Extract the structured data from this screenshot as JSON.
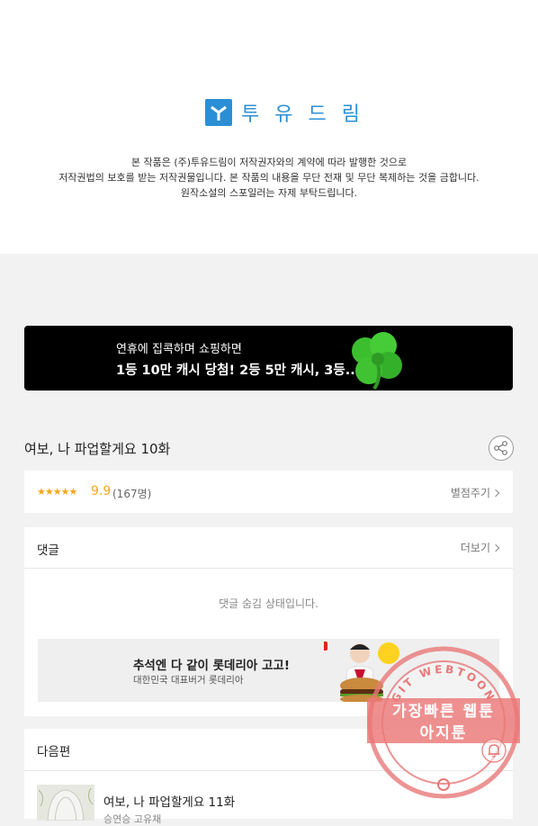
{
  "header": {
    "logo_text": "투 유 드 림",
    "notice": [
      "본 작품은 (주)투유드림이 저작권자와의 계약에 따라 발행한 것으로",
      "저작권법의 보호를 받는 저작권물입니다. 본 작품의 내용을 무단 전재 및 무단 복제하는 것을 금합니다.",
      "원작소설의 스포일러는 자제 부탁드립니다."
    ]
  },
  "banner": {
    "line1": "연휴에 집콕하며 쇼핑하면",
    "line2": "1등 10만 캐시 당첨! 2등 5만 캐시, 3등.."
  },
  "episode": {
    "title": "여보, 나 파업할게요 10화",
    "share_icon": "share-icon"
  },
  "rating": {
    "stars": "★★★★★",
    "score": "9.9",
    "count": "(167명)",
    "rate_label": "별점주기"
  },
  "comments": {
    "heading": "댓글",
    "more_label": "더보기",
    "hidden_message": "댓글 숨김 상태입니다."
  },
  "ad": {
    "title": "추석엔 다 같이 롯데리아 고고!",
    "subtitle": "대한민국 대표버거 롯데리아"
  },
  "next": {
    "heading": "다음편",
    "item_title": "여보, 나 파업할게요 11화",
    "item_sub": "승연승 고유채"
  },
  "watermark": {
    "line1": "가장빠른 웹툰",
    "line2": "아지툰",
    "ring_text": "GIT WEBTOON"
  },
  "colors": {
    "brand": "#2b8fd6",
    "star": "#f5a623",
    "watermark": "#e87878"
  }
}
